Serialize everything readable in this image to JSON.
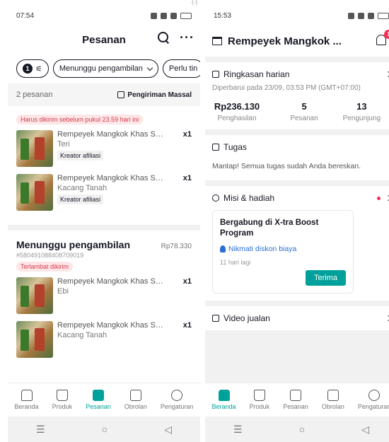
{
  "left": {
    "status": {
      "time": "07:54"
    },
    "header": {
      "title": "Pesanan"
    },
    "filters": {
      "badge": "1",
      "status_chip": "Menunggu pengambilan",
      "next_chip": "Perlu tin"
    },
    "list": {
      "count": "2 pesanan",
      "bulk_label": "Pengiriman Massal"
    },
    "orders": [
      {
        "warning": "Harus dikirim sebelum pukul 23.59 hari ini",
        "items": [
          {
            "name": "Rempeyek Mangkok Khas Sido...",
            "qty": "x1",
            "variant": "Teri",
            "tag": "Kreator afiliasi"
          },
          {
            "name": "Rempeyek Mangkok Khas Sido...",
            "qty": "x1",
            "variant": "Kacang Tanah",
            "tag": "Kreator afiliasi"
          }
        ]
      },
      {
        "status": "Menunggu pengambilan",
        "price": "Rp78.330",
        "id": "#580491088408709019",
        "warning": "Terlambat dikirim",
        "items": [
          {
            "name": "Rempeyek Mangkok Khas Sido...",
            "qty": "x1",
            "variant": "Ebi"
          },
          {
            "name": "Rempeyek Mangkok Khas Sido...",
            "qty": "x1",
            "variant": "Kacang Tanah"
          }
        ]
      }
    ],
    "nav": [
      {
        "label": "Beranda",
        "icon": "home-icon"
      },
      {
        "label": "Produk",
        "icon": "bag-icon"
      },
      {
        "label": "Pesanan",
        "icon": "orders-icon",
        "active": true
      },
      {
        "label": "Obrolan",
        "icon": "chat-icon"
      },
      {
        "label": "Pengaturan",
        "icon": "gear-icon"
      }
    ]
  },
  "right": {
    "status": {
      "time": "15:53"
    },
    "header": {
      "shop_name": "Rempeyek Mangkok ...",
      "notif_count": "1"
    },
    "daily": {
      "title": "Ringkasan harian",
      "updated": "Diperbarui pada 23/09, 03:53 PM (GMT+07:00)",
      "revenue_value": "Rp236.130",
      "revenue_label": "Penghasilan",
      "orders_value": "5",
      "orders_label": "Pesanan",
      "visitors_value": "13",
      "visitors_label": "Pengunjung"
    },
    "tasks": {
      "title": "Tugas",
      "message": "Mantap! Semua tugas sudah Anda bereskan."
    },
    "missions": {
      "title": "Misi & hadiah",
      "promo_title": "Bergabung di X-tra Boost Program",
      "promo_link": "Nikmati diskon biaya",
      "promo_time": "11 hari lagi",
      "accept_label": "Terima"
    },
    "video": {
      "title": "Video jualan"
    },
    "nav": [
      {
        "label": "Beranda",
        "icon": "home-icon",
        "active": true
      },
      {
        "label": "Produk",
        "icon": "bag-icon"
      },
      {
        "label": "Pesanan",
        "icon": "orders-icon"
      },
      {
        "label": "Obrolan",
        "icon": "chat-icon"
      },
      {
        "label": "Pengaturan",
        "icon": "gear-icon"
      }
    ]
  },
  "colors": {
    "accent": "#00a19a",
    "alert": "#fe2c55",
    "link": "#2a6fd4"
  }
}
